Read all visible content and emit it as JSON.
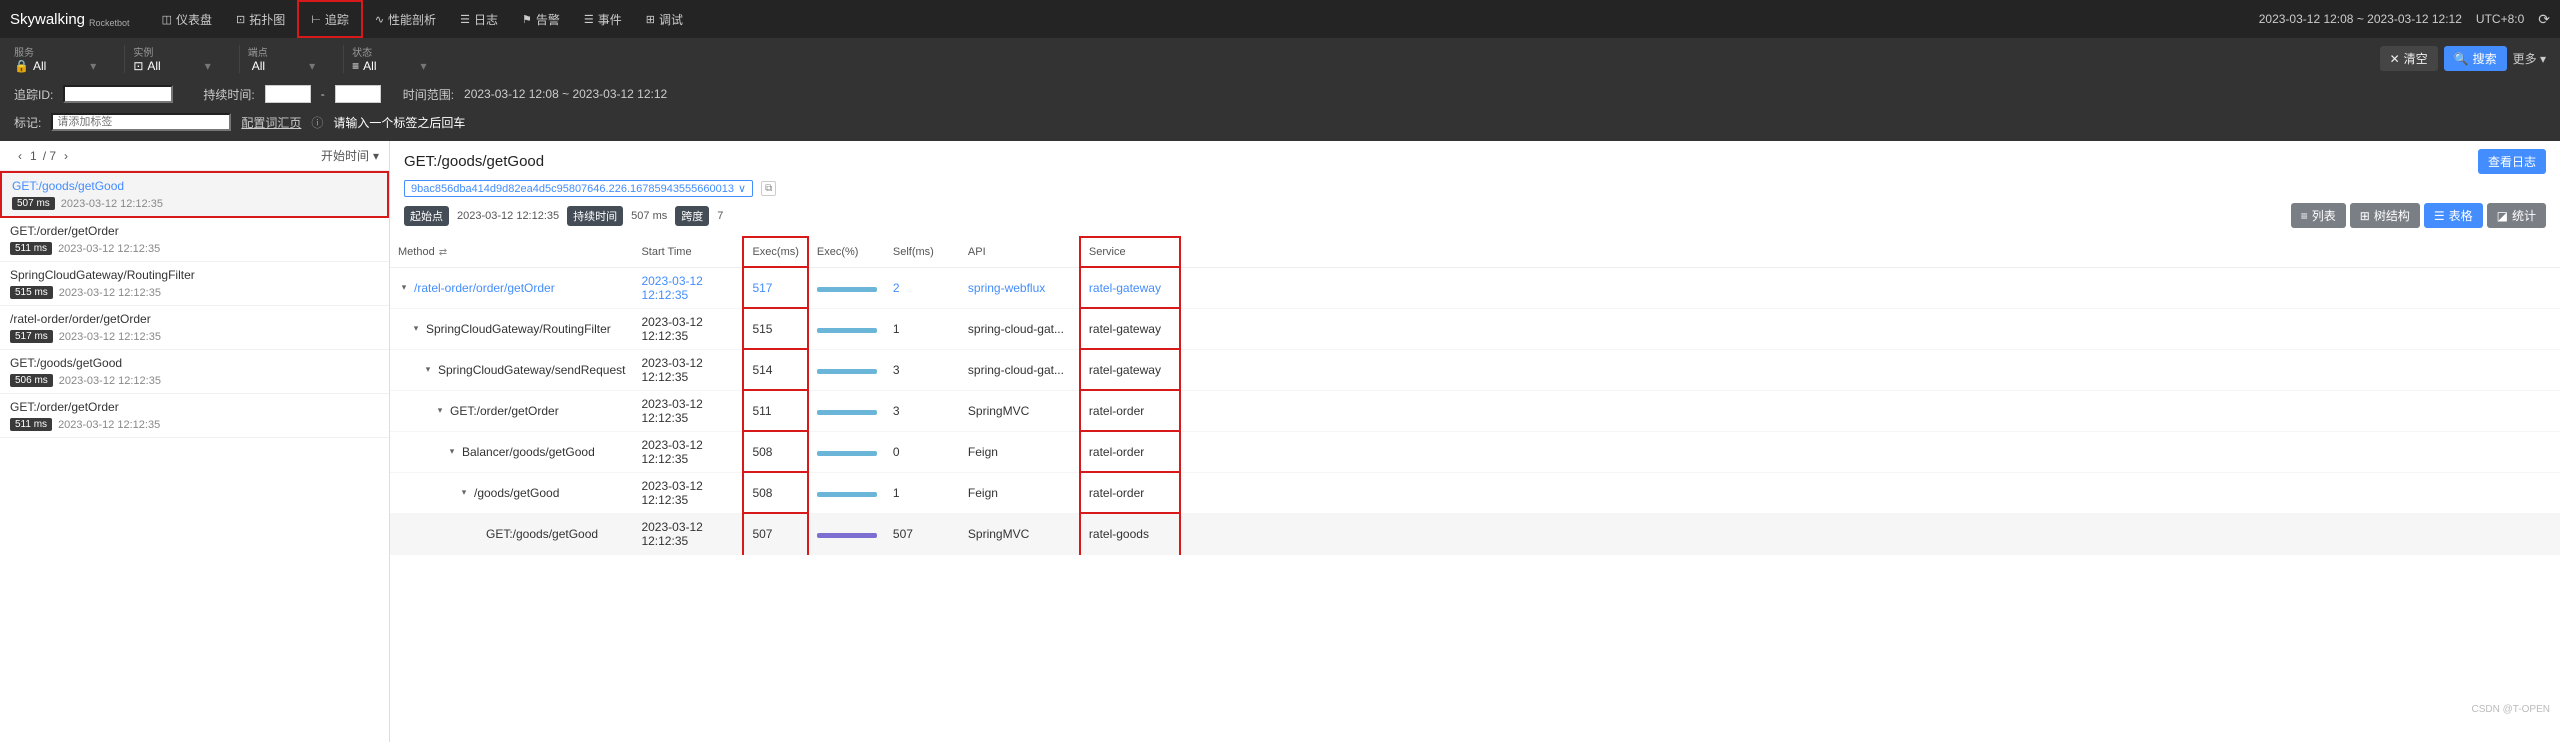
{
  "header": {
    "logo": "Skywalking",
    "sublogo": "Rocketbot",
    "nav": [
      {
        "label": "仪表盘",
        "icon": "◫"
      },
      {
        "label": "拓扑图",
        "icon": "⊡"
      },
      {
        "label": "追踪",
        "icon": "⊢"
      },
      {
        "label": "性能剖析",
        "icon": "∿"
      },
      {
        "label": "日志",
        "icon": "☰"
      },
      {
        "label": "告警",
        "icon": "⚑"
      },
      {
        "label": "事件",
        "icon": "☰"
      },
      {
        "label": "调试",
        "icon": "⊞"
      }
    ],
    "timerange": "2023-03-12 12:08 ~ 2023-03-12 12:12",
    "tz": "UTC+8:0"
  },
  "filters": {
    "groups": [
      {
        "icon": "🔒",
        "label": "服务",
        "value": "All"
      },
      {
        "icon": "⊡",
        "label": "实例",
        "value": "All"
      },
      {
        "icon": "</>",
        "label": "端点",
        "value": "All"
      },
      {
        "icon": "≡",
        "label": "状态",
        "value": "All"
      }
    ],
    "clear": "清空",
    "search": "搜索",
    "more": "更多"
  },
  "filters2": {
    "traceid_lbl": "追踪ID:",
    "duration_lbl": "持续时间:",
    "sep": "-",
    "timerange_lbl": "时间范围:",
    "timerange_val": "2023-03-12 12:08 ~ 2023-03-12 12:12",
    "tag_lbl": "标记:",
    "tag_placeholder": "请添加标签",
    "link": "配置词汇页",
    "hint": "请输入一个标签之后回车"
  },
  "pager": {
    "page": "1",
    "total": "/ 7",
    "sort": "开始时间"
  },
  "traces": [
    {
      "name": "GET:/goods/getGood",
      "dur": "507 ms",
      "ts": "2023-03-12 12:12:35",
      "sel": true
    },
    {
      "name": "GET:/order/getOrder",
      "dur": "511 ms",
      "ts": "2023-03-12 12:12:35"
    },
    {
      "name": "SpringCloudGateway/RoutingFilter",
      "dur": "515 ms",
      "ts": "2023-03-12 12:12:35"
    },
    {
      "name": "/ratel-order/order/getOrder",
      "dur": "517 ms",
      "ts": "2023-03-12 12:12:35"
    },
    {
      "name": "GET:/goods/getGood",
      "dur": "506 ms",
      "ts": "2023-03-12 12:12:35"
    },
    {
      "name": "GET:/order/getOrder",
      "dur": "511 ms",
      "ts": "2023-03-12 12:12:35"
    }
  ],
  "detail": {
    "title": "GET:/goods/getGood",
    "traceid": "9bac856dba414d9d82ea4d5c95807646.226.16785943555660013",
    "logbtn": "查看日志",
    "start_lbl": "起始点",
    "start_val": "2023-03-12 12:12:35",
    "dur_lbl": "持续时间",
    "dur_val": "507 ms",
    "span_lbl": "跨度",
    "span_val": "7",
    "views": {
      "list": "列表",
      "tree": "树结构",
      "table": "表格",
      "stat": "统计"
    }
  },
  "columns": {
    "method": "Method",
    "start": "Start Time",
    "exec": "Exec(ms)",
    "execp": "Exec(%)",
    "self": "Self(ms)",
    "api": "API",
    "service": "Service"
  },
  "spans": [
    {
      "lvl": 0,
      "method": "/ratel-order/order/getOrder",
      "start": "2023-03-12 12:12:35",
      "exec": "517",
      "self": "2",
      "api": "spring-webflux",
      "service": "ratel-gateway",
      "linked": true
    },
    {
      "lvl": 1,
      "method": "SpringCloudGateway/RoutingFilter",
      "start": "2023-03-12 12:12:35",
      "exec": "515",
      "self": "1",
      "api": "spring-cloud-gat...",
      "service": "ratel-gateway"
    },
    {
      "lvl": 2,
      "method": "SpringCloudGateway/sendRequest",
      "start": "2023-03-12 12:12:35",
      "exec": "514",
      "self": "3",
      "api": "spring-cloud-gat...",
      "service": "ratel-gateway"
    },
    {
      "lvl": 3,
      "method": "GET:/order/getOrder",
      "start": "2023-03-12 12:12:35",
      "exec": "511",
      "self": "3",
      "api": "SpringMVC",
      "service": "ratel-order"
    },
    {
      "lvl": 4,
      "method": "Balancer/goods/getGood",
      "start": "2023-03-12 12:12:35",
      "exec": "508",
      "self": "0",
      "api": "Feign",
      "service": "ratel-order"
    },
    {
      "lvl": 5,
      "method": "/goods/getGood",
      "start": "2023-03-12 12:12:35",
      "exec": "508",
      "self": "1",
      "api": "Feign",
      "service": "ratel-order"
    },
    {
      "lvl": 6,
      "method": "GET:/goods/getGood",
      "start": "2023-03-12 12:12:35",
      "exec": "507",
      "self": "507",
      "api": "SpringMVC",
      "service": "ratel-goods",
      "last": true
    }
  ],
  "watermark": "CSDN @T-OPEN"
}
